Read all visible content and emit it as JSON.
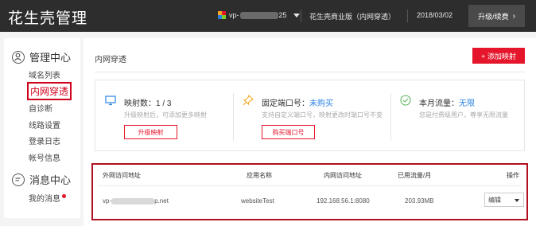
{
  "header": {
    "brand": "花生壳管理",
    "account_prefix": "vp-",
    "account_suffix": "25",
    "edition": "花生壳商业版（内网穿透）",
    "date": "2018/03/02",
    "upgrade_label": "升级/续费",
    "upgrade_chevron": "›"
  },
  "sidebar": {
    "manage_section": "管理中心",
    "items": [
      {
        "label": "域名列表",
        "active": false
      },
      {
        "label": "内网穿透",
        "active": true
      },
      {
        "label": "自诊断",
        "active": false
      },
      {
        "label": "线路设置",
        "active": false
      },
      {
        "label": "登录日志",
        "active": false
      },
      {
        "label": "帐号信息",
        "active": false
      }
    ],
    "message_section": "消息中心",
    "my_messages": "我的消息"
  },
  "main": {
    "title": "内网穿透",
    "add_button": "+ 添加映射",
    "stats": [
      {
        "title": "映射数：1 / 3",
        "highlight": "",
        "desc": "升级映射后，可添加更多映射",
        "button": "升级映射",
        "icon": "monitor-icon"
      },
      {
        "title": "固定端口号：",
        "highlight": "未购买",
        "desc": "支持自定义端口号，映射更改时端口号不变",
        "button": "购买端口号",
        "icon": "pin-icon"
      },
      {
        "title": "本月流量：",
        "highlight": "无限",
        "desc": "您是付费级用户，尊享无限流量",
        "button": "",
        "icon": "check-circle-icon"
      }
    ],
    "table": {
      "headers": [
        "外网访问地址",
        "应用名称",
        "内网访问地址",
        "已用流量/月",
        "操作"
      ],
      "rows": [
        {
          "external_prefix": "vp-",
          "external_suffix": "p.net",
          "app": "websiteTest",
          "internal": "192.168.56.1:8080",
          "traffic": "203.93MB",
          "op": "编辑"
        }
      ]
    }
  },
  "colors": {
    "accent_red": "#e5162c",
    "highlight_blue": "#2a82e4",
    "header_bg": "#2d2d2d"
  }
}
